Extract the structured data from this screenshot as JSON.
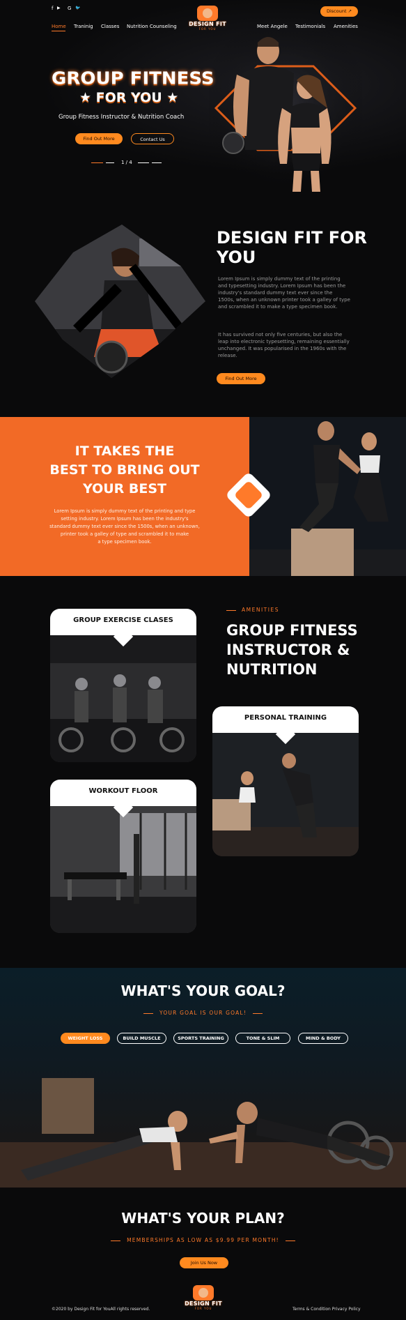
{
  "header": {
    "social": [
      "f",
      "▶",
      "G",
      "🐦"
    ],
    "nav_left": [
      "Home",
      "Traninig",
      "Classes",
      "Nutrition Counseling"
    ],
    "nav_right": [
      "Meet Angele",
      "Testimonials",
      "Amenities"
    ],
    "discount_label": "Discount",
    "logo": {
      "title": "DESIGN FIT",
      "subtitle": "FOR YOU"
    }
  },
  "hero": {
    "title_line1": "GROUP FITNESS",
    "title_line2": "★ FOR YOU ★",
    "subtitle": "Group Fitness Instructor & Nutrition Coach",
    "btn_primary": "Find Out More",
    "btn_secondary": "Contact Us",
    "slide_indicator": "1 / 4"
  },
  "about": {
    "title": "DESIGN FIT FOR YOU",
    "paragraph1": "Lorem Ipsum is simply dummy text of the printing and typesetting industry. Lorem Ipsum has been the industry's standard dummy text ever since the 1500s, when an unknown printer took a galley of type and scrambled it to make a type specimen book.",
    "paragraph2": "It has survived not only five centuries, but also the leap into electronic typesetting, remaining essentially unchanged. It was popularised in the 1960s with the release.",
    "button": "Find Out More"
  },
  "motivation": {
    "title_lines": [
      "IT TAKES THE",
      "BEST TO BRING OUT",
      "YOUR BEST"
    ],
    "text_lines": [
      "Lorem Ipsum is simply dummy text of the printing and type",
      "setting industry. Lorem Ipsum has been the industry's",
      "standard dummy text ever since the 1500s, when an unknown,",
      "printer took a galley of type and scrambled it to make",
      "a type specimen book."
    ]
  },
  "amenities": {
    "eyebrow": "AMENITIES",
    "title_lines": [
      "GROUP FITNESS",
      "INSTRUCTOR &",
      "NUTRITION"
    ],
    "cards": [
      "GROUP EXERCISE CLASES",
      "PERSONAL TRAINING",
      "WORKOUT FLOOR"
    ]
  },
  "goal": {
    "title": "WHAT'S YOUR GOAL?",
    "subtitle": "YOUR GOAL IS OUR GOAL!",
    "tabs": [
      "WEIGHT LOSS",
      "BUILD MUSCLE",
      "SPORTS TRAINING",
      "TONE & SLIM",
      "MIND & BODY"
    ]
  },
  "plan": {
    "title": "WHAT'S YOUR PLAN?",
    "subtitle": "MEMBERSHIPS AS LOW AS $9.99 PER MONTH!",
    "button": "Join Us Now"
  },
  "footer": {
    "copyright": "©2020 by Design Fit for YouAll rights reserved.",
    "links": "Terms & Condition Privacy Policy"
  },
  "colors": {
    "accent": "#ff8a1f",
    "orange_panel": "#f26a26",
    "background": "#0a0a0b"
  }
}
